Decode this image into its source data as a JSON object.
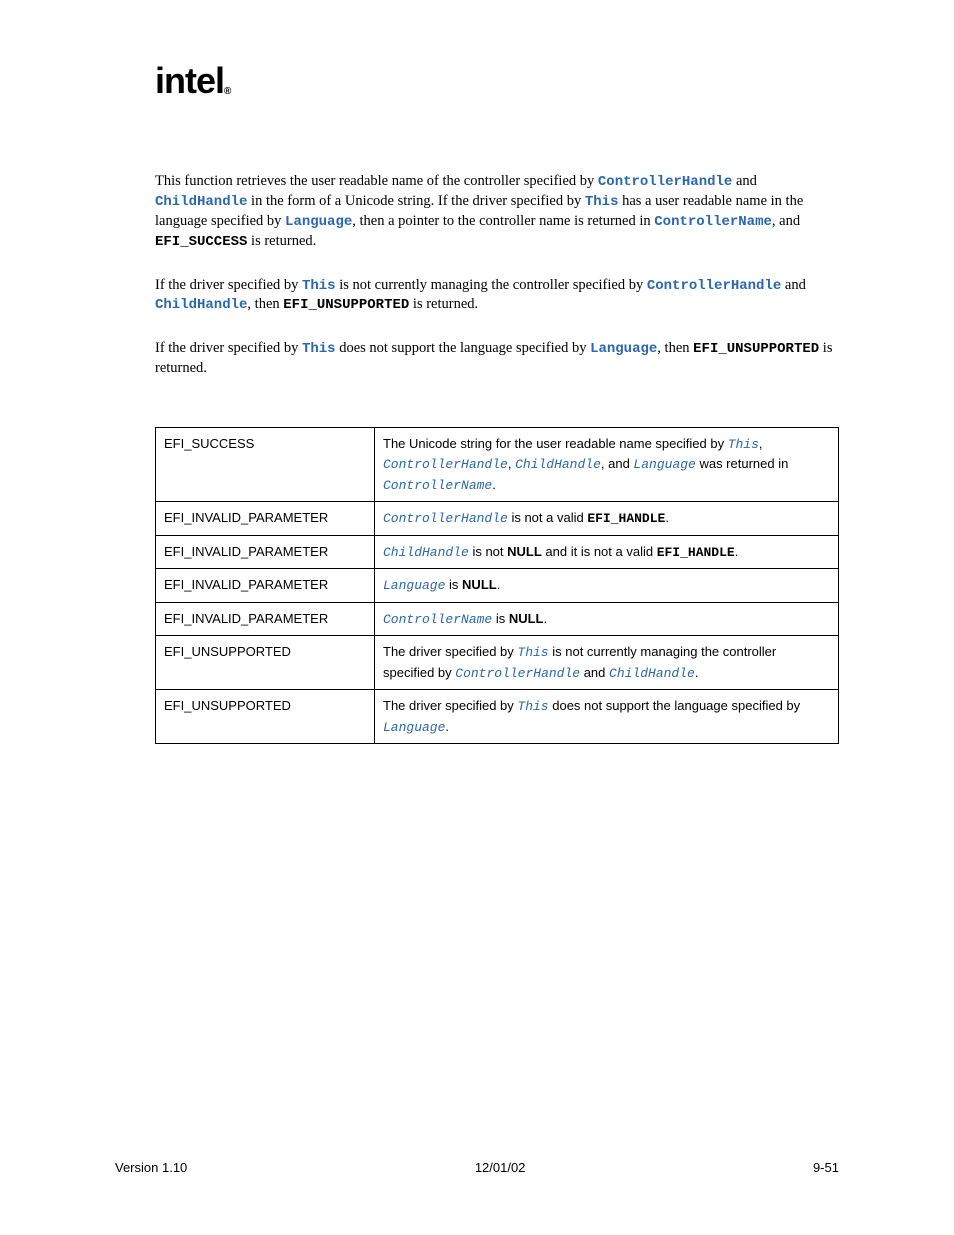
{
  "logo": "intel",
  "para1": {
    "t1": "This function retrieves the user readable name of the controller specified by ",
    "c1": "ControllerHandle",
    "t2": " and ",
    "c2": "ChildHandle",
    "t3": " in the form of a Unicode string.  If the driver specified by ",
    "c3": "This",
    "t4": " has a user readable name in the language specified by ",
    "c4": "Language",
    "t5": ", then a pointer to the controller name is returned in ",
    "c5": "ControllerName",
    "t6": ", and ",
    "c6": "EFI_SUCCESS",
    "t7": " is returned."
  },
  "para2": {
    "t1": "If the driver specified by ",
    "c1": "This",
    "t2": " is not currently managing the controller specified by ",
    "c2": "ControllerHandle",
    "t3": " and ",
    "c3": "ChildHandle",
    "t4": ", then ",
    "c4": "EFI_UNSUPPORTED",
    "t5": " is returned."
  },
  "para3": {
    "t1": "If the driver specified by ",
    "c1": "This",
    "t2": " does not support the language specified by ",
    "c2": "Language",
    "t3": ", then ",
    "c3": "EFI_UNSUPPORTED",
    "t4": " is returned."
  },
  "table": {
    "r0": {
      "status": "EFI_SUCCESS",
      "d1": "The Unicode string for the user readable name specified by ",
      "c1": "This",
      "d2": ", ",
      "c2": "ControllerHandle",
      "d3": ", ",
      "c3": "ChildHandle",
      "d4": ", and ",
      "c4": "Language",
      "d5": " was returned in ",
      "c5": "ControllerName",
      "d6": "."
    },
    "r1": {
      "status": "EFI_INVALID_PARAMETER",
      "c1": "ControllerHandle",
      "d1": " is not a valid ",
      "b1": "EFI_HANDLE",
      "d2": "."
    },
    "r2": {
      "status": "EFI_INVALID_PARAMETER",
      "c1": "ChildHandle",
      "d1": " is not ",
      "b1": "NULL",
      "d2": " and it is not a valid ",
      "b2": "EFI_HANDLE",
      "d3": "."
    },
    "r3": {
      "status": "EFI_INVALID_PARAMETER",
      "c1": "Language",
      "d1": " is ",
      "b1": "NULL",
      "d2": "."
    },
    "r4": {
      "status": "EFI_INVALID_PARAMETER",
      "c1": "ControllerName",
      "d1": " is ",
      "b1": "NULL",
      "d2": "."
    },
    "r5": {
      "status": "EFI_UNSUPPORTED",
      "d1": "The driver specified by ",
      "c1": "This",
      "d2": " is not currently managing the controller specified by ",
      "c2": "ControllerHandle",
      "d3": " and ",
      "c3": "ChildHandle",
      "d4": "."
    },
    "r6": {
      "status": "EFI_UNSUPPORTED",
      "d1": "The driver specified by ",
      "c1": "This",
      "d2": " does not support the language specified by ",
      "c2": "Language",
      "d3": "."
    }
  },
  "footer": {
    "left": "Version 1.10",
    "center": "12/01/02",
    "right": "9-51"
  }
}
